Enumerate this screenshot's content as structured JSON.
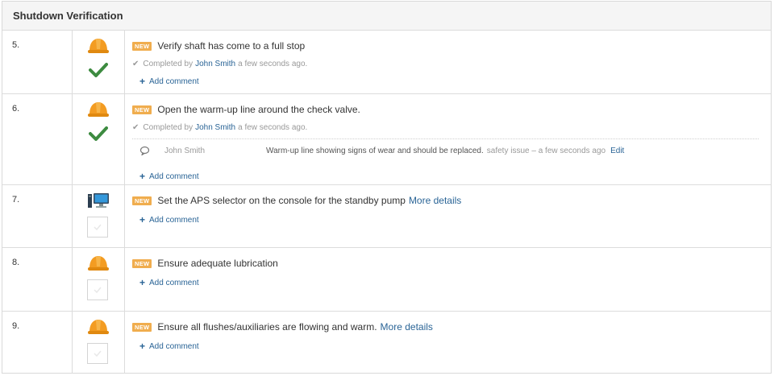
{
  "section": {
    "title": "Shutdown Verification"
  },
  "badge_label": "NEW",
  "add_comment_label": "Add comment",
  "colors": {
    "badge": "#f0ad4e",
    "link": "#2a6496",
    "check": "#3d8b40",
    "hardhat": "#f39c22"
  },
  "tasks": [
    {
      "number": "5.",
      "icon": "hardhat-icon",
      "title": "Verify shaft has come to a full stop",
      "status": "completed",
      "completed": {
        "prefix": "Completed by",
        "user": "John Smith",
        "suffix": "a few seconds ago."
      }
    },
    {
      "number": "6.",
      "icon": "hardhat-icon",
      "title": "Open the warm-up line around the check valve.",
      "status": "completed",
      "completed": {
        "prefix": "Completed by",
        "user": "John Smith",
        "suffix": "a few seconds ago."
      },
      "comment": {
        "author": "John Smith",
        "text": "Warm-up line showing signs of wear and should be replaced.",
        "tag": "safety issue – a few seconds ago",
        "edit": "Edit"
      }
    },
    {
      "number": "7.",
      "icon": "computer-icon",
      "title": "Set the APS selector on the console for the standby pump",
      "more": "More details",
      "status": "pending"
    },
    {
      "number": "8.",
      "icon": "hardhat-icon",
      "title": "Ensure adequate lubrication",
      "status": "pending"
    },
    {
      "number": "9.",
      "icon": "hardhat-icon",
      "title": "Ensure all flushes/auxiliaries are flowing and warm.",
      "more": "More details",
      "status": "pending"
    }
  ]
}
